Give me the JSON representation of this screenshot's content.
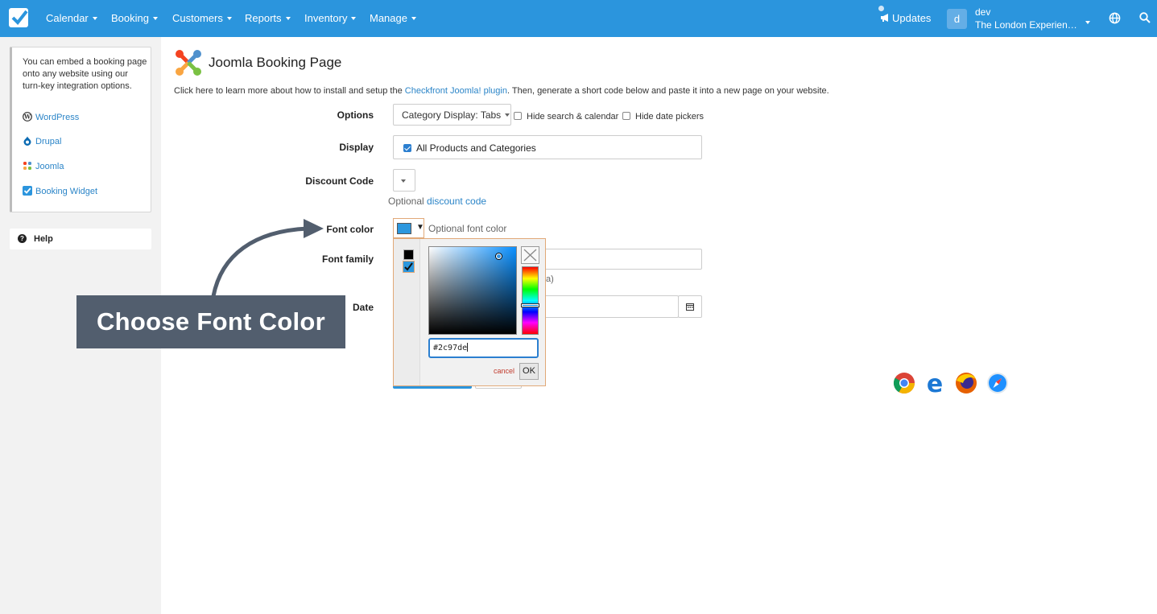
{
  "nav": {
    "items": [
      "Calendar",
      "Booking",
      "Customers",
      "Reports",
      "Inventory",
      "Manage"
    ],
    "updates_label": "Updates",
    "avatar_letter": "d",
    "user_name": "dev",
    "user_company": "The London Experienc...",
    "icons": [
      "checkfront-logo-icon",
      "megaphone-icon",
      "globe-icon",
      "search-icon"
    ]
  },
  "sidebar": {
    "embed_text": "You can embed a booking page onto any website using our turn-key integration options.",
    "links": [
      "WordPress",
      "Drupal",
      "Joomla",
      "Booking Widget"
    ],
    "help_label": "Help"
  },
  "main": {
    "title": "Joomla Booking Page",
    "intro_prefix": "Click here to learn more about how to install and setup the ",
    "intro_link": "Checkfront Joomla! plugin",
    "intro_suffix": ". Then, generate a short code below and paste it into a new page on your website.",
    "options_label": "Options",
    "category_display": "Category Display: Tabs",
    "hide_search_label": "Hide search & calendar",
    "hide_date_label": "Hide date pickers",
    "display_label": "Display",
    "display_value": "All Products and Categories",
    "discount_label": "Discount Code",
    "discount_hint_prefix": "Optional ",
    "discount_hint_link": "discount code",
    "font_color_label": "Font color",
    "font_color_hint": "Optional font color",
    "font_family_label": "Font family",
    "font_family_hint_tail": "a)",
    "date_label": "Date"
  },
  "picker": {
    "hex_value": "#2c97de",
    "cancel_label": "cancel",
    "ok_label": "OK",
    "selected_color": "#2c97de"
  },
  "annotation": {
    "callout_text": "Choose Font Color"
  },
  "browsers": [
    "chrome-icon",
    "edge-icon",
    "firefox-icon",
    "safari-icon"
  ]
}
